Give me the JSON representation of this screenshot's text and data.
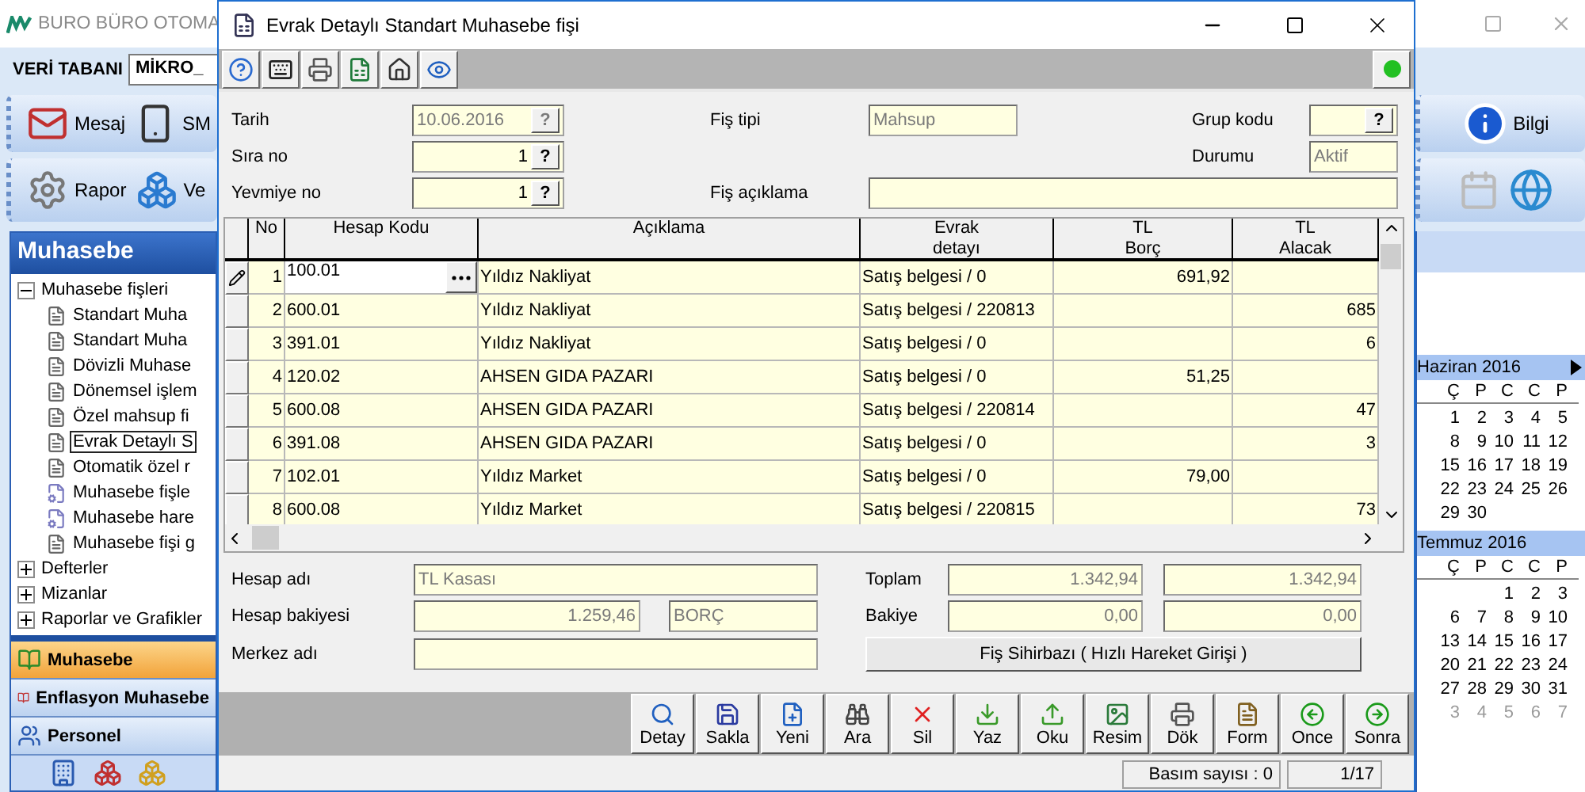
{
  "background_app": {
    "title": "BURO BÜRO OTOMA",
    "database_label": "VERİ TABANI",
    "database_value": "MİKRO_",
    "toolbar_1": [
      {
        "label": "Mesaj"
      },
      {
        "label": "SM"
      }
    ],
    "toolbar_2": [
      {
        "label": "Rapor"
      },
      {
        "label": "Ve"
      }
    ],
    "panel_title": "Muhasebe",
    "tree": [
      {
        "label": "Muhasebe fişleri",
        "expanded": true,
        "children": [
          {
            "label": "Standart Muha",
            "kind": "form",
            "selected": false
          },
          {
            "label": "Standart Muha",
            "kind": "form",
            "selected": false
          },
          {
            "label": "Dövizli Muhase",
            "kind": "form",
            "selected": false
          },
          {
            "label": "Dönemsel işlem",
            "kind": "form",
            "selected": false
          },
          {
            "label": "Özel mahsup fi",
            "kind": "form",
            "selected": false
          },
          {
            "label": "Evrak Detaylı S",
            "kind": "form",
            "selected": true
          },
          {
            "label": "Otomatik özel r",
            "kind": "form",
            "selected": false
          },
          {
            "label": "Muhasebe fişle",
            "kind": "report",
            "selected": false
          },
          {
            "label": "Muhasebe hare",
            "kind": "report",
            "selected": false
          },
          {
            "label": "Muhasebe fişi g",
            "kind": "form",
            "selected": false
          }
        ]
      },
      {
        "label": "Defterler",
        "expanded": false
      },
      {
        "label": "Mizanlar",
        "expanded": false
      },
      {
        "label": "Raporlar ve Grafikler",
        "expanded": false
      }
    ],
    "sections": [
      {
        "label": "Muhasebe",
        "selected": true
      },
      {
        "label": "Enflasyon Muhasebe",
        "selected": false
      },
      {
        "label": "Personel",
        "selected": false
      }
    ],
    "right_toolbar": [
      {
        "label": "Bilgi"
      }
    ],
    "calendars": [
      {
        "month": "Haziran 2016",
        "weekdays": [
          "Ç",
          "P",
          "C",
          "C",
          "P"
        ],
        "weeks": [
          {
            "days": [
              "1",
              "2",
              "3",
              "4",
              "5"
            ],
            "muted": false
          },
          {
            "days": [
              "8",
              "9",
              "10",
              "11",
              "12"
            ],
            "muted": false
          },
          {
            "days": [
              "15",
              "16",
              "17",
              "18",
              "19"
            ],
            "muted": false
          },
          {
            "days": [
              "22",
              "23",
              "24",
              "25",
              "26"
            ],
            "muted": false
          },
          {
            "days": [
              "29",
              "30"
            ],
            "muted": false
          }
        ]
      },
      {
        "month": "Temmuz 2016",
        "weekdays": [
          "Ç",
          "P",
          "C",
          "C",
          "P"
        ],
        "weeks": [
          {
            "days": [
              "1",
              "2",
              "3"
            ],
            "muted": false
          },
          {
            "days": [
              "6",
              "7",
              "8",
              "9",
              "10"
            ],
            "muted": false
          },
          {
            "days": [
              "13",
              "14",
              "15",
              "16",
              "17"
            ],
            "muted": false
          },
          {
            "days": [
              "20",
              "21",
              "22",
              "23",
              "24"
            ],
            "muted": false
          },
          {
            "days": [
              "27",
              "28",
              "29",
              "30",
              "31"
            ],
            "muted": false
          },
          {
            "days": [
              "3",
              "4",
              "5",
              "6",
              "7"
            ],
            "muted": true
          }
        ]
      }
    ]
  },
  "dialog": {
    "title": "Evrak Detaylı Standart Muhasebe fişi",
    "fields": [
      {
        "label": "Tarih",
        "value": "10.06.2016",
        "disabled": true,
        "lookup_button": "?"
      },
      {
        "label": "Fiş tipi",
        "value": "Mahsup",
        "disabled": true
      },
      {
        "label": "Grup kodu",
        "lookup_button": "?"
      },
      {
        "label": "Sıra no",
        "value": "1",
        "disabled": false,
        "lookup_button": "?"
      },
      {
        "label": "Durumu",
        "value": "Aktif",
        "disabled": true
      },
      {
        "label": "Yevmiye no",
        "value": "1",
        "disabled": false,
        "lookup_button": "?"
      },
      {
        "label": "Fiş açıklama"
      }
    ],
    "grid": {
      "columns": [
        {
          "lines": [
            "No"
          ]
        },
        {
          "lines": [
            "Hesap Kodu"
          ]
        },
        {
          "lines": [
            "Açıklama"
          ]
        },
        {
          "lines": [
            "Evrak",
            "detayı"
          ]
        },
        {
          "lines": [
            "TL",
            "Borç"
          ]
        },
        {
          "lines": [
            "TL",
            "Alacak"
          ]
        }
      ],
      "rows": [
        {
          "no": "1",
          "account": "100.01",
          "description": "Yıldız Nakliyat",
          "document": "Satış belgesi / 0",
          "debit": "691,92",
          "current": true
        },
        {
          "no": "2",
          "account": "600.01",
          "description": "Yıldız Nakliyat",
          "document": "Satış belgesi / 220813",
          "credit": "685",
          "current": false
        },
        {
          "no": "3",
          "account": "391.01",
          "description": "Yıldız Nakliyat",
          "document": "Satış belgesi / 0",
          "credit": "6",
          "current": false
        },
        {
          "no": "4",
          "account": "120.02",
          "description": "AHSEN GIDA PAZARI",
          "document": "Satış belgesi / 0",
          "debit": "51,25",
          "current": false
        },
        {
          "no": "5",
          "account": "600.08",
          "description": "AHSEN GIDA PAZARI",
          "document": "Satış belgesi / 220814",
          "credit": "47",
          "current": false
        },
        {
          "no": "6",
          "account": "391.08",
          "description": "AHSEN GIDA PAZARI",
          "document": "Satış belgesi / 0",
          "credit": "3",
          "current": false
        },
        {
          "no": "7",
          "account": "102.01",
          "description": "Yıldız Market",
          "document": "Satış belgesi / 0",
          "debit": "79,00",
          "current": false
        },
        {
          "no": "8",
          "account": "600.08",
          "description": "Yıldız Market",
          "document": "Satış belgesi / 220815",
          "credit": "73",
          "current": false
        }
      ]
    },
    "account_name": {
      "label": "Hesap adı",
      "value": "TL Kasası"
    },
    "account_balance": {
      "label": "Hesap bakiyesi",
      "value": "1.259,46",
      "side": "BORÇ"
    },
    "center_name": {
      "label": "Merkez adı"
    },
    "totals": [
      {
        "label": "Toplam",
        "debit": "1.342,94",
        "credit": "1.342,94"
      },
      {
        "label": "Bakiye",
        "debit": "0,00",
        "credit": "0,00"
      }
    ],
    "wizard_button": "Fiş Sihirbazı ( Hızlı Hareket Girişi )",
    "buttons": [
      "Detay",
      "Sakla",
      "Yeni",
      "Ara",
      "Sil",
      "Yaz",
      "Oku",
      "Resim",
      "Dök",
      "Form",
      "Once",
      "Sonra"
    ],
    "status_bar": {
      "print_count": "Basım sayısı : 0",
      "record": "1/17"
    }
  }
}
